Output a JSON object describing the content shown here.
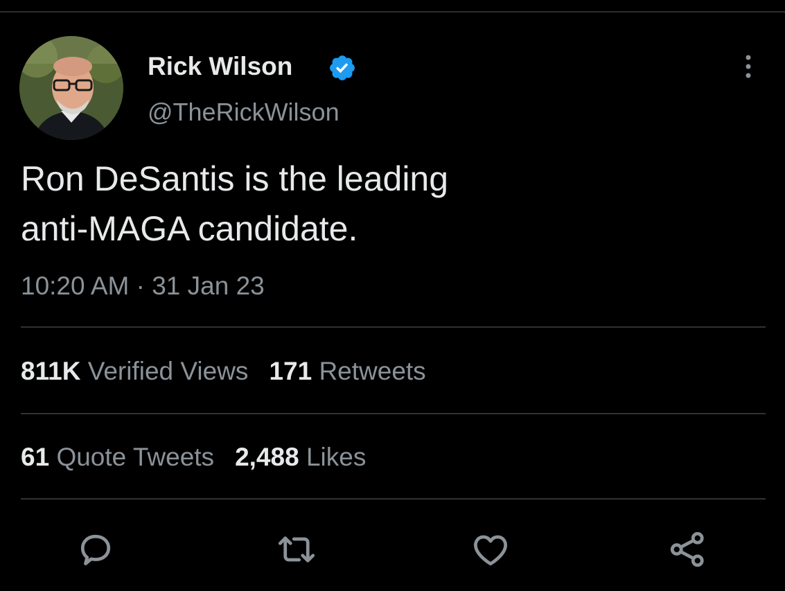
{
  "tweet": {
    "author": {
      "display_name": "Rick Wilson",
      "handle": "@TheRickWilson",
      "verified": true
    },
    "text_line1": "Ron DeSantis is the leading",
    "text_line2": "anti-MAGA candidate.",
    "timestamp": "10:20 AM · 31 Jan 23",
    "stats": {
      "views_count": "811K",
      "views_label": "Verified Views",
      "retweets_count": "171",
      "retweets_label": "Retweets",
      "quotes_count": "61",
      "quotes_label": "Quote Tweets",
      "likes_count": "2,488",
      "likes_label": "Likes"
    },
    "actions": [
      "reply-icon",
      "retweet-icon",
      "like-icon",
      "share-icon"
    ]
  },
  "colors": {
    "background": "#000000",
    "primary_text": "#e7e9ea",
    "secondary_text": "#8b9298",
    "divider": "#2f3336",
    "verified_blue": "#1d9bf0"
  }
}
